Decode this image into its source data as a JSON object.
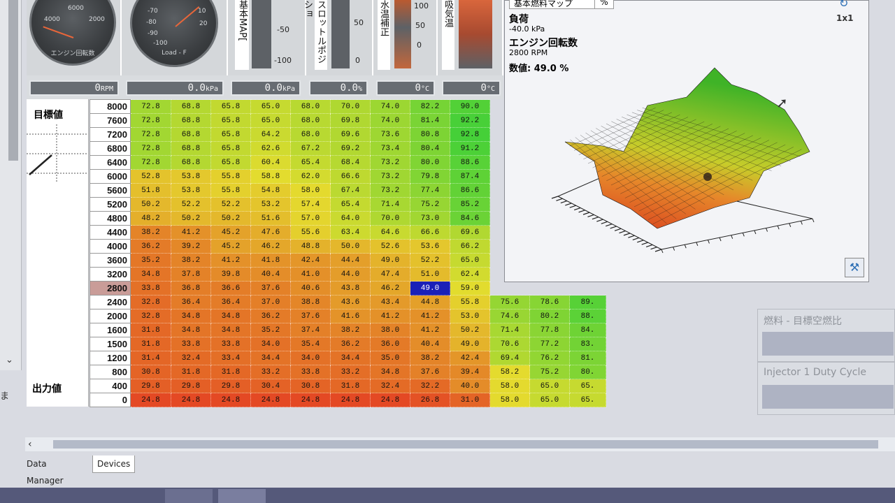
{
  "gauges": {
    "tacho": {
      "label": "エンジン回転数",
      "ticks": [
        "6000",
        "4000",
        "2000"
      ],
      "readout_value": "0",
      "readout_unit": "RPM"
    },
    "load": {
      "label": "Load - F",
      "ticks": [
        "-70",
        "-80",
        "-90",
        "-100",
        "10",
        "20"
      ],
      "readout_value": "0.0",
      "readout_unit": "kPa"
    },
    "bars": [
      {
        "label": "基本MAP[",
        "ticks": [
          "-50",
          "-100"
        ],
        "readout_value": "0.0",
        "readout_unit": "kPa"
      },
      {
        "label": "スロットルポジショ",
        "ticks": [
          "50",
          "0"
        ],
        "readout_value": "0.0",
        "readout_unit": "%"
      },
      {
        "label": "水温補正",
        "ticks": [
          "100",
          "50",
          "0"
        ],
        "readout_value": "0",
        "readout_unit": "°C"
      },
      {
        "label": "吸気温",
        "ticks": [
          "100",
          "50",
          "0"
        ],
        "readout_value": "0",
        "readout_unit": "°C"
      }
    ]
  },
  "left_panel": {
    "target_label": "目標値",
    "output_label": "出力値",
    "edge_char": "ま"
  },
  "fuel_map": {
    "rpm": [
      "8000",
      "7600",
      "7200",
      "6800",
      "6400",
      "6000",
      "5600",
      "5200",
      "4800",
      "4400",
      "4000",
      "3600",
      "3200",
      "2800",
      "2400",
      "2000",
      "1600",
      "1500",
      "1200",
      "800",
      "400",
      "0"
    ],
    "selected_row": 13,
    "selected_col": 7,
    "rows": [
      [
        "72.8",
        "68.8",
        "65.8",
        "65.0",
        "68.0",
        "70.0",
        "74.0",
        "82.2",
        "90.0",
        "",
        "",
        ""
      ],
      [
        "72.8",
        "68.8",
        "65.8",
        "65.0",
        "68.0",
        "69.8",
        "74.0",
        "81.4",
        "92.2",
        "",
        "",
        ""
      ],
      [
        "72.8",
        "68.8",
        "65.8",
        "64.2",
        "68.0",
        "69.6",
        "73.6",
        "80.8",
        "92.8",
        "",
        "",
        ""
      ],
      [
        "72.8",
        "68.8",
        "65.8",
        "62.6",
        "67.2",
        "69.2",
        "73.4",
        "80.4",
        "91.2",
        "",
        "",
        ""
      ],
      [
        "72.8",
        "68.8",
        "65.8",
        "60.4",
        "65.4",
        "68.4",
        "73.2",
        "80.0",
        "88.6",
        "",
        "",
        ""
      ],
      [
        "52.8",
        "53.8",
        "55.8",
        "58.8",
        "62.0",
        "66.6",
        "73.2",
        "79.8",
        "87.4",
        "",
        "",
        ""
      ],
      [
        "51.8",
        "53.8",
        "55.8",
        "54.8",
        "58.0",
        "67.4",
        "73.2",
        "77.4",
        "86.6",
        "",
        "",
        ""
      ],
      [
        "50.2",
        "52.2",
        "52.2",
        "53.2",
        "57.4",
        "65.4",
        "71.4",
        "75.2",
        "85.2",
        "",
        "",
        ""
      ],
      [
        "48.2",
        "50.2",
        "50.2",
        "51.6",
        "57.0",
        "64.0",
        "70.0",
        "73.0",
        "84.6",
        "",
        "",
        ""
      ],
      [
        "38.2",
        "41.2",
        "45.2",
        "47.6",
        "55.6",
        "63.4",
        "64.6",
        "66.6",
        "69.6",
        "",
        "",
        ""
      ],
      [
        "36.2",
        "39.2",
        "45.2",
        "46.2",
        "48.8",
        "50.0",
        "52.6",
        "53.6",
        "66.2",
        "",
        "",
        ""
      ],
      [
        "35.2",
        "38.2",
        "41.2",
        "41.8",
        "42.4",
        "44.4",
        "49.0",
        "52.2",
        "65.0",
        "",
        "",
        ""
      ],
      [
        "34.8",
        "37.8",
        "39.8",
        "40.4",
        "41.0",
        "44.0",
        "47.4",
        "51.0",
        "62.4",
        "",
        "",
        ""
      ],
      [
        "33.8",
        "36.8",
        "36.6",
        "37.6",
        "40.6",
        "43.8",
        "46.2",
        "49.0",
        "59.0",
        "",
        "",
        ""
      ],
      [
        "32.8",
        "36.4",
        "36.4",
        "37.0",
        "38.8",
        "43.6",
        "43.4",
        "44.8",
        "55.8",
        "75.6",
        "78.6",
        "89."
      ],
      [
        "32.8",
        "34.8",
        "34.8",
        "36.2",
        "37.6",
        "41.6",
        "41.2",
        "41.2",
        "53.0",
        "74.6",
        "80.2",
        "88."
      ],
      [
        "31.8",
        "34.8",
        "34.8",
        "35.2",
        "37.4",
        "38.2",
        "38.0",
        "41.2",
        "50.2",
        "71.4",
        "77.8",
        "84."
      ],
      [
        "31.8",
        "33.8",
        "33.8",
        "34.0",
        "35.4",
        "36.2",
        "36.0",
        "40.4",
        "49.0",
        "70.6",
        "77.2",
        "83."
      ],
      [
        "31.4",
        "32.4",
        "33.4",
        "34.4",
        "34.0",
        "34.4",
        "35.0",
        "38.2",
        "42.4",
        "69.4",
        "76.2",
        "81."
      ],
      [
        "30.8",
        "31.8",
        "31.8",
        "33.2",
        "33.8",
        "33.2",
        "34.8",
        "37.6",
        "39.4",
        "58.2",
        "75.2",
        "80."
      ],
      [
        "29.8",
        "29.8",
        "29.8",
        "30.4",
        "30.8",
        "31.8",
        "32.4",
        "32.2",
        "40.0",
        "58.0",
        "65.0",
        "65."
      ],
      [
        "24.8",
        "24.8",
        "24.8",
        "24.8",
        "24.8",
        "24.8",
        "24.8",
        "26.8",
        "31.0",
        "58.0",
        "65.0",
        "65."
      ]
    ]
  },
  "map3d": {
    "tab_label": "基本燃料マップ",
    "tab2_label": "%",
    "grid_label": "1x1",
    "load_label": "負荷",
    "load_value": "-40.0 kPa",
    "rpm_label": "エンジン回転数",
    "rpm_value": "2800 RPM",
    "value_text": "数値: 49.0 %"
  },
  "side_panels": {
    "fuel_target": "燃料 - 目標空燃比",
    "injector": "Injector 1 Duty Cycle"
  },
  "bottom_tabs": [
    "Data Manager",
    "Devices"
  ],
  "icons": {
    "refresh": "refresh-icon",
    "tools": "tools-icon",
    "cursor": "cursor-icon",
    "scroll_left": "chevron-left-icon",
    "scroll_down": "chevron-down-icon"
  }
}
